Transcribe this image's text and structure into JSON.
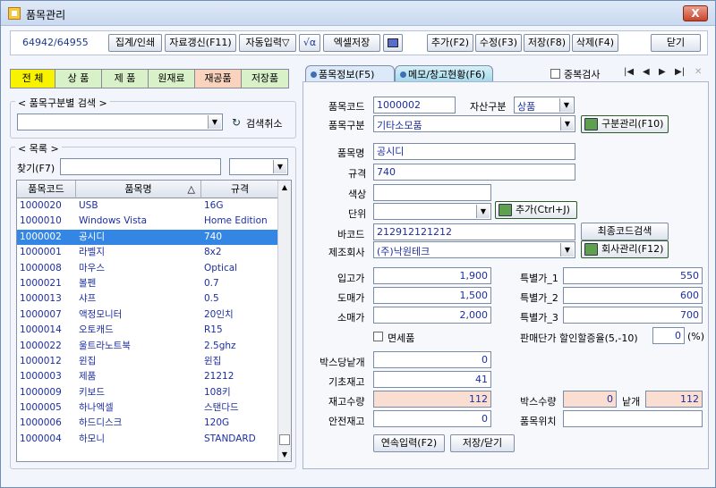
{
  "window": {
    "title": "품목관리",
    "close": "X"
  },
  "toolbar": {
    "code": "64942/64955",
    "sum_print": "집계/인쇄",
    "refresh": "자료갱신(F11)",
    "auto_input": "자동입력▽",
    "calc": "√α",
    "excel_save": "엑셀저장",
    "add": "추가(F2)",
    "edit": "수정(F3)",
    "save": "저장(F8)",
    "delete": "삭제(F4)",
    "close": "닫기"
  },
  "categories": [
    {
      "label": "전 체",
      "color": "#f6f200"
    },
    {
      "label": "상 품",
      "color": "#d8f1c8"
    },
    {
      "label": "제 품",
      "color": "#d8f1c8"
    },
    {
      "label": "원재료",
      "color": "#d8f1c8"
    },
    {
      "label": "재공품",
      "color": "#f9d3bd"
    },
    {
      "label": "저장품",
      "color": "#d8f1c8"
    }
  ],
  "search_group": {
    "title": "품목구분별 검색",
    "cancel": "검색취소"
  },
  "list_group": {
    "title": "목록",
    "find_label": "찾기(F7)"
  },
  "grid": {
    "headers": [
      "품목코드",
      "품목명",
      "규격"
    ],
    "sort_indicator": "△",
    "rows": [
      {
        "code": "1000020",
        "name": "USB",
        "spec": "16G"
      },
      {
        "code": "1000010",
        "name": "Windows Vista",
        "spec": "Home Edition"
      },
      {
        "code": "1000002",
        "name": "공시디",
        "spec": "740"
      },
      {
        "code": "1000001",
        "name": "라벨지",
        "spec": "8x2"
      },
      {
        "code": "1000008",
        "name": "마우스",
        "spec": "Optical"
      },
      {
        "code": "1000021",
        "name": "볼펜",
        "spec": "0.7"
      },
      {
        "code": "1000013",
        "name": "샤프",
        "spec": "0.5"
      },
      {
        "code": "1000007",
        "name": "액정모니터",
        "spec": "20인치"
      },
      {
        "code": "1000014",
        "name": "오토캐드",
        "spec": "R15"
      },
      {
        "code": "1000022",
        "name": "울트라노트북",
        "spec": "2.5ghz"
      },
      {
        "code": "1000012",
        "name": "윈집",
        "spec": "윈집"
      },
      {
        "code": "1000003",
        "name": "제품",
        "spec": "21212"
      },
      {
        "code": "1000009",
        "name": "키보드",
        "spec": "108키"
      },
      {
        "code": "1000005",
        "name": "하나엑셀",
        "spec": "스탠다드"
      },
      {
        "code": "1000006",
        "name": "하드디스크",
        "spec": "120G"
      },
      {
        "code": "1000004",
        "name": "하모니",
        "spec": "STANDARD"
      }
    ],
    "selected_index": 2
  },
  "tabs": {
    "info": "품목정보(F5)",
    "memo": "메모/창고현황(F6)",
    "dup_check": "중복검사"
  },
  "nav": {
    "first": "|◀",
    "prev": "◀",
    "next": "▶",
    "last": "▶|",
    "close": "✕"
  },
  "form": {
    "code_label": "품목코드",
    "code": "1000002",
    "asset_label": "자산구분",
    "asset": "상품",
    "category_label": "품목구분",
    "category": "기타소모품",
    "category_btn": "구분관리(F10)",
    "name_label": "품목명",
    "name": "공시디",
    "spec_label": "규격",
    "spec": "740",
    "color_label": "색상",
    "color": "",
    "unit_label": "단위",
    "unit": "",
    "unit_btn": "추가(Ctrl+J)",
    "barcode_label": "바코드",
    "barcode": "212912121212",
    "barcode_btn": "최종코드검색",
    "maker_label": "제조회사",
    "maker": "(주)낙원테크",
    "maker_btn": "회사관리(F12)",
    "buy_label": "입고가",
    "buy": "1,900",
    "wholesale_label": "도매가",
    "wholesale": "1,500",
    "retail_label": "소매가",
    "retail": "2,000",
    "sp1_label": "특별가_1",
    "sp1": "550",
    "sp2_label": "특별가_2",
    "sp2": "600",
    "sp3_label": "특별가_3",
    "sp3": "700",
    "taxfree_label": "면세품",
    "discount_label": "판매단가 할인할증율(5,-10)",
    "discount": "0",
    "discount_unit": "(%)",
    "box_each_label": "박스당낱개",
    "box_each": "0",
    "base_stock_label": "기초재고",
    "base_stock": "41",
    "stock_label": "재고수량",
    "stock": "112",
    "box_qty_label": "박스수량",
    "box_qty": "0",
    "each_label": "낱개",
    "each": "112",
    "safe_label": "안전재고",
    "safe": "0",
    "location_label": "품목위치",
    "location": "",
    "continuous_btn": "연속입력(F2)",
    "save_close_btn": "저장/닫기"
  }
}
